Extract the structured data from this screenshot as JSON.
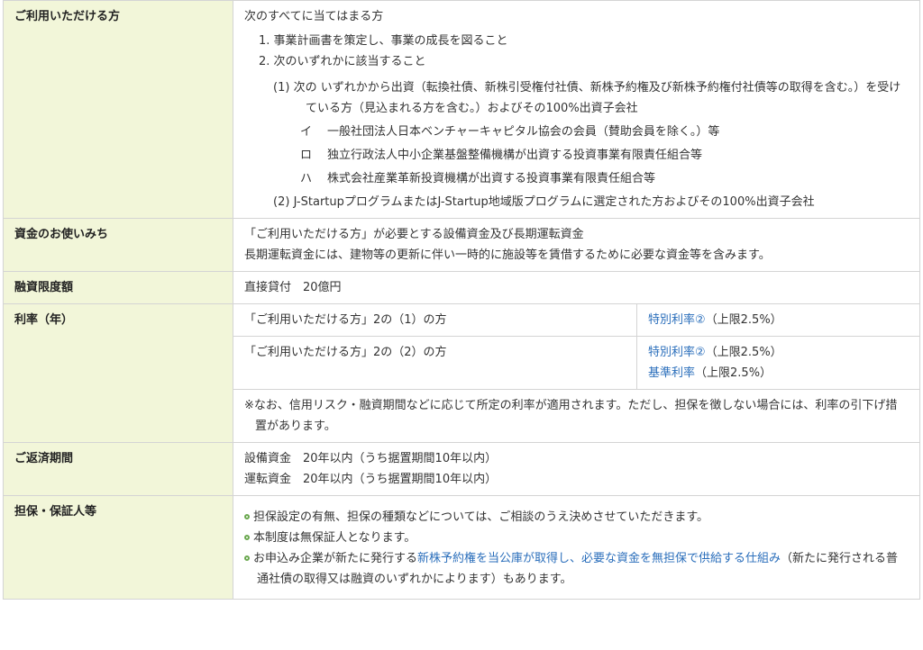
{
  "eligible": {
    "header": "ご利用いただける方",
    "intro": "次のすべてに当てはまる方",
    "items": [
      "1. 事業計画書を策定し、事業の成長を図ること",
      "2. 次のいずれかに該当すること"
    ],
    "sub1_mark": "(1)",
    "sub1_text": "次の いずれかから出資（転換社債、新株引受権付社債、新株予約権及び新株予約権付社債等の取得を含む。）を受けている方（見込まれる方を含む。）およびその100%出資子会社",
    "kana": [
      {
        "mark": "イ",
        "text": "一般社団法人日本ベンチャーキャピタル協会の会員（賛助会員を除く。）等"
      },
      {
        "mark": "ロ",
        "text": "独立行政法人中小企業基盤整備機構が出資する投資事業有限責任組合等"
      },
      {
        "mark": "ハ",
        "text": "株式会社産業革新投資機構が出資する投資事業有限責任組合等"
      }
    ],
    "sub2_mark": "(2)",
    "sub2_text": "J-StartupプログラムまたはJ-Startup地域版プログラムに選定された方およびその100%出資子会社"
  },
  "use": {
    "header": "資金のお使いみち",
    "line1": "「ご利用いただける方」が必要とする設備資金及び長期運転資金",
    "line2": "長期運転資金には、建物等の更新に伴い一時的に施設等を賃借するために必要な資金等を含みます。"
  },
  "limit": {
    "header": "融資限度額",
    "value": "直接貸付　20億円"
  },
  "rate": {
    "header": "利率（年）",
    "row1_label": "「ご利用いただける方」2の（1）の方",
    "row1_link": "特別利率②",
    "row1_suffix": "（上限2.5%）",
    "row2_label": "「ご利用いただける方」2の（2）の方",
    "row2_link1": "特別利率②",
    "row2_suffix1": "（上限2.5%）",
    "row2_link2": "基準利率",
    "row2_suffix2": "（上限2.5%）",
    "note": "※なお、信用リスク・融資期間などに応じて所定の利率が適用されます。ただし、担保を徴しない場合には、利率の引下げ措置があります。"
  },
  "repay": {
    "header": "ご返済期間",
    "line1": "設備資金　20年以内（うち据置期間10年以内）",
    "line2": "運転資金　20年以内（うち据置期間10年以内）"
  },
  "collateral": {
    "header": "担保・保証人等",
    "b1": "担保設定の有無、担保の種類などについては、ご相談のうえ決めさせていただきます。",
    "b2": "本制度は無保証人となります。",
    "b3_pre": "お申込み企業が新たに発行する",
    "b3_link": "新株予約権を当公庫が取得し、必要な資金を無担保で供給する仕組み",
    "b3_post": "（新たに発行される普通社債の取得又は融資のいずれかによります）もあります。"
  },
  "colors": {
    "header_bg": "#f2f6d9",
    "link": "#2a6ebb",
    "bullet": "#6aa84f",
    "border": "#d4d4d4"
  }
}
